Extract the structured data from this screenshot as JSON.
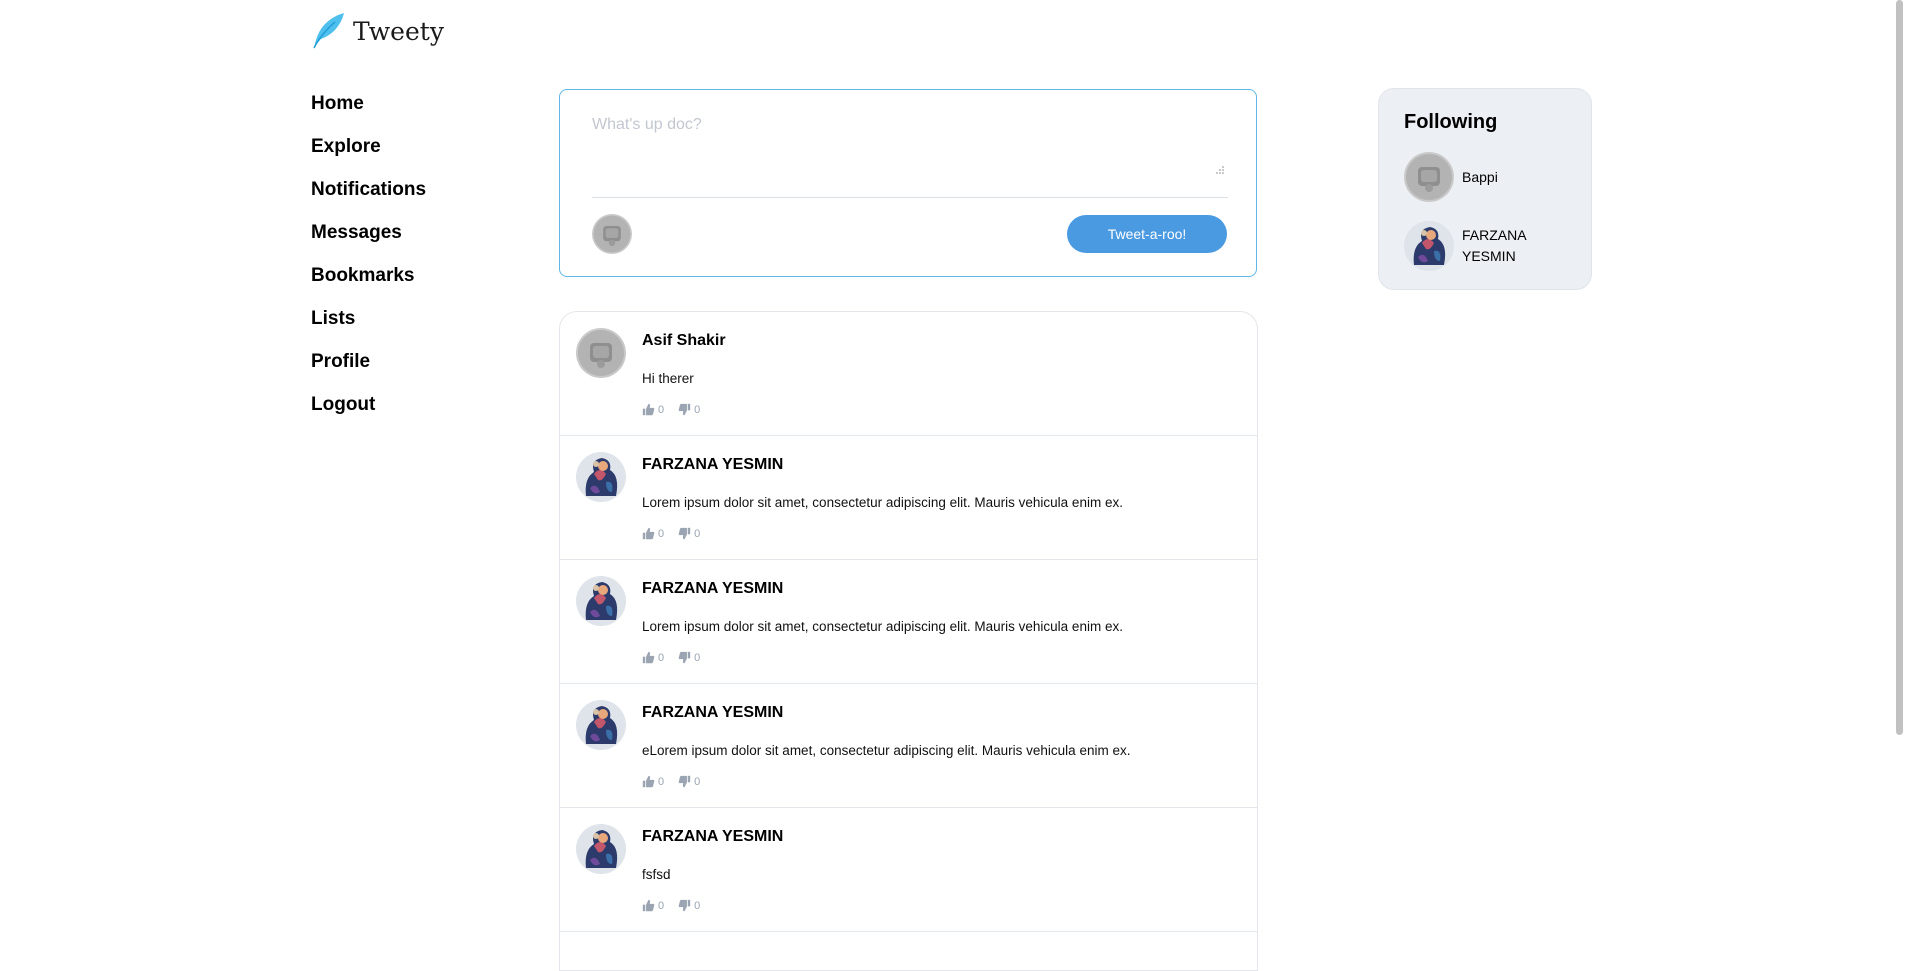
{
  "brand": {
    "name": "Tweety"
  },
  "nav": {
    "items": [
      {
        "label": "Home"
      },
      {
        "label": "Explore"
      },
      {
        "label": "Notifications"
      },
      {
        "label": "Messages"
      },
      {
        "label": "Bookmarks"
      },
      {
        "label": "Lists"
      },
      {
        "label": "Profile"
      },
      {
        "label": "Logout"
      }
    ]
  },
  "composer": {
    "placeholder": "What's up doc?",
    "submit_label": "Tweet-a-roo!"
  },
  "feed": {
    "tweets": [
      {
        "author": "Asif Shakir",
        "body": "Hi therer",
        "likes": "0",
        "dislikes": "0",
        "avatar": "default-avatar"
      },
      {
        "author": "FARZANA YESMIN",
        "body": "Lorem ipsum dolor sit amet, consectetur adipiscing elit. Mauris vehicula enim ex.",
        "likes": "0",
        "dislikes": "0",
        "avatar": "art-avatar"
      },
      {
        "author": "FARZANA YESMIN",
        "body": "Lorem ipsum dolor sit amet, consectetur adipiscing elit. Mauris vehicula enim ex.",
        "likes": "0",
        "dislikes": "0",
        "avatar": "art-avatar"
      },
      {
        "author": "FARZANA YESMIN",
        "body": "eLorem ipsum dolor sit amet, consectetur adipiscing elit. Mauris vehicula enim ex.",
        "likes": "0",
        "dislikes": "0",
        "avatar": "art-avatar"
      },
      {
        "author": "FARZANA YESMIN",
        "body": "fsfsd",
        "likes": "0",
        "dislikes": "0",
        "avatar": "art-avatar"
      }
    ]
  },
  "following": {
    "title": "Following",
    "users": [
      {
        "name": "Bappi",
        "avatar": "default-avatar"
      },
      {
        "name": "FARZANA YESMIN",
        "avatar": "art-avatar"
      }
    ]
  },
  "colors": {
    "accent": "#4a9ae2",
    "composer_border": "#60b7e6",
    "sidebar_bg": "#ecf0f4",
    "muted": "#9aa4b2"
  }
}
